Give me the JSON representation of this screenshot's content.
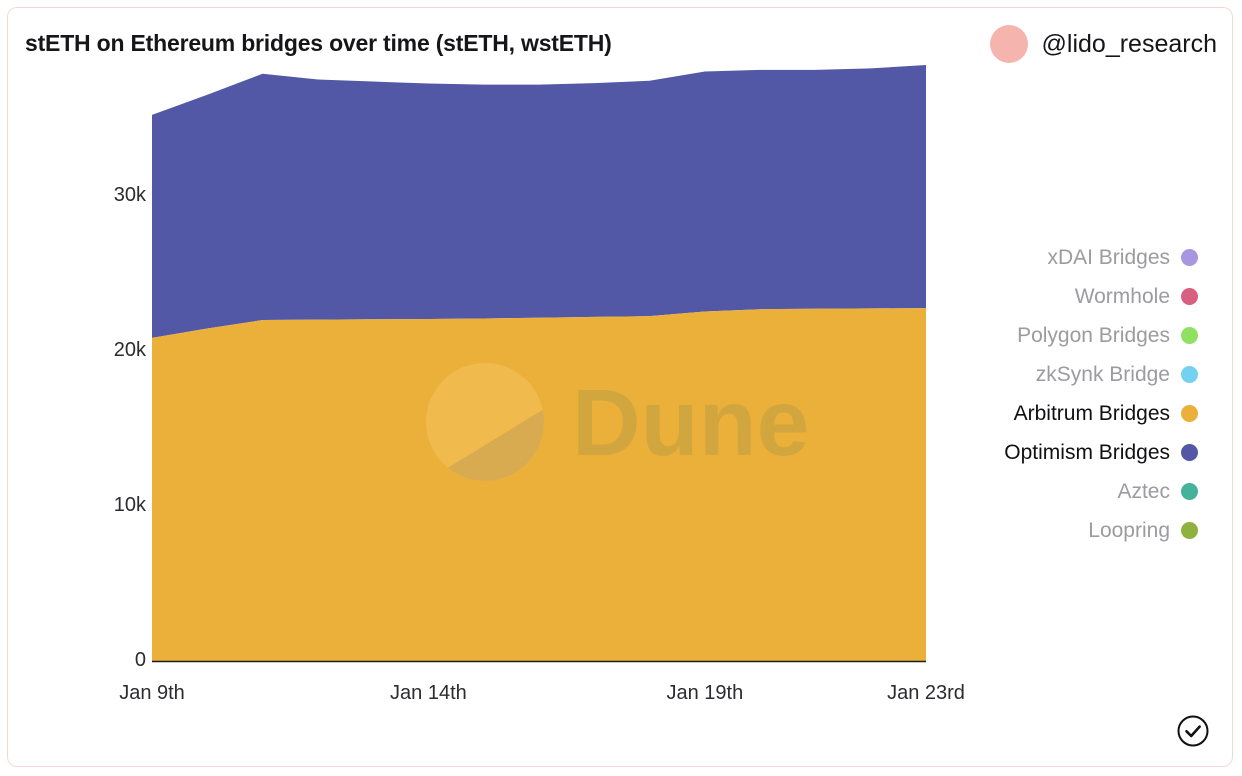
{
  "header": {
    "title": "stETH on Ethereum bridges over time (stETH, wstETH)",
    "handle": "@lido_research",
    "avatar_color": "#f5b4ad"
  },
  "watermark": {
    "text": "Dune"
  },
  "legend": [
    {
      "label": "xDAI Bridges",
      "color": "#a995e0",
      "active": false
    },
    {
      "label": "Wormhole",
      "color": "#d75f80",
      "active": false
    },
    {
      "label": "Polygon Bridges",
      "color": "#8fe063",
      "active": false
    },
    {
      "label": "zkSynk Bridge",
      "color": "#74d2f0",
      "active": false
    },
    {
      "label": "Arbitrum Bridges",
      "color": "#eab03a",
      "active": true
    },
    {
      "label": "Optimism Bridges",
      "color": "#5258a5",
      "active": true
    },
    {
      "label": "Aztec",
      "color": "#47b29b",
      "active": false
    },
    {
      "label": "Loopring",
      "color": "#8fb23f",
      "active": false
    }
  ],
  "chart_data": {
    "type": "area",
    "title": "stETH on Ethereum bridges over time (stETH, wstETH)",
    "xlabel": "",
    "ylabel": "",
    "stacked": true,
    "grid": false,
    "legend_position": "right",
    "ylim": [
      0,
      36000
    ],
    "ytick_values": [
      0,
      10000,
      20000,
      30000
    ],
    "ytick_labels": [
      "0",
      "10k",
      "20k",
      "30k"
    ],
    "xtick_labels": [
      "Jan 9th",
      "Jan 14th",
      "Jan 19th",
      "Jan 23rd"
    ],
    "xtick_positions": [
      0,
      5,
      10,
      14
    ],
    "x": [
      "Jan 9th",
      "Jan 10th",
      "Jan 11th",
      "Jan 12th",
      "Jan 13th",
      "Jan 14th",
      "Jan 15th",
      "Jan 16th",
      "Jan 17th",
      "Jan 18th",
      "Jan 19th",
      "Jan 20th",
      "Jan 21st",
      "Jan 22nd",
      "Jan 23rd"
    ],
    "series": [
      {
        "name": "Arbitrum Bridges",
        "color": "#eab03a",
        "values": [
          20900,
          21500,
          22050,
          22080,
          22100,
          22120,
          22150,
          22200,
          22250,
          22300,
          22600,
          22750,
          22780,
          22800,
          22820
        ]
      },
      {
        "name": "Optimism Bridges",
        "color": "#5258a5",
        "values": [
          14400,
          15100,
          15900,
          15500,
          15350,
          15200,
          15100,
          15050,
          15100,
          15200,
          15500,
          15450,
          15420,
          15500,
          15700
        ]
      },
      {
        "name": "xDAI Bridges",
        "color": "#a995e0",
        "values": [
          0,
          0,
          0,
          0,
          0,
          0,
          0,
          0,
          0,
          0,
          0,
          0,
          0,
          0,
          0
        ]
      },
      {
        "name": "Wormhole",
        "color": "#d75f80",
        "values": [
          0,
          0,
          0,
          0,
          0,
          0,
          0,
          0,
          0,
          0,
          0,
          0,
          0,
          0,
          0
        ]
      },
      {
        "name": "Polygon Bridges",
        "color": "#8fe063",
        "values": [
          0,
          0,
          0,
          0,
          0,
          0,
          0,
          0,
          0,
          0,
          0,
          0,
          0,
          0,
          0
        ]
      },
      {
        "name": "zkSynk Bridge",
        "color": "#74d2f0",
        "values": [
          0,
          0,
          0,
          0,
          0,
          0,
          0,
          0,
          0,
          0,
          0,
          0,
          0,
          0,
          0
        ]
      },
      {
        "name": "Aztec",
        "color": "#47b29b",
        "values": [
          0,
          0,
          0,
          0,
          0,
          0,
          0,
          0,
          0,
          0,
          0,
          0,
          0,
          0,
          0
        ]
      },
      {
        "name": "Loopring",
        "color": "#8fb23f",
        "values": [
          0,
          0,
          0,
          0,
          0,
          0,
          0,
          0,
          0,
          0,
          0,
          0,
          0,
          0,
          0
        ]
      }
    ]
  },
  "footer": {
    "verified_icon": "check-circle-icon"
  }
}
